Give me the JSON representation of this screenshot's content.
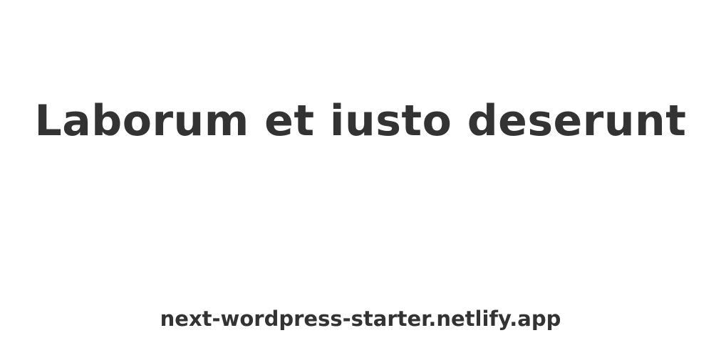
{
  "post": {
    "title": "Laborum et iusto deserunt"
  },
  "site": {
    "url": "next-wordpress-starter.netlify.app"
  },
  "colors": {
    "background": "#ffffff",
    "text": "#333333"
  }
}
